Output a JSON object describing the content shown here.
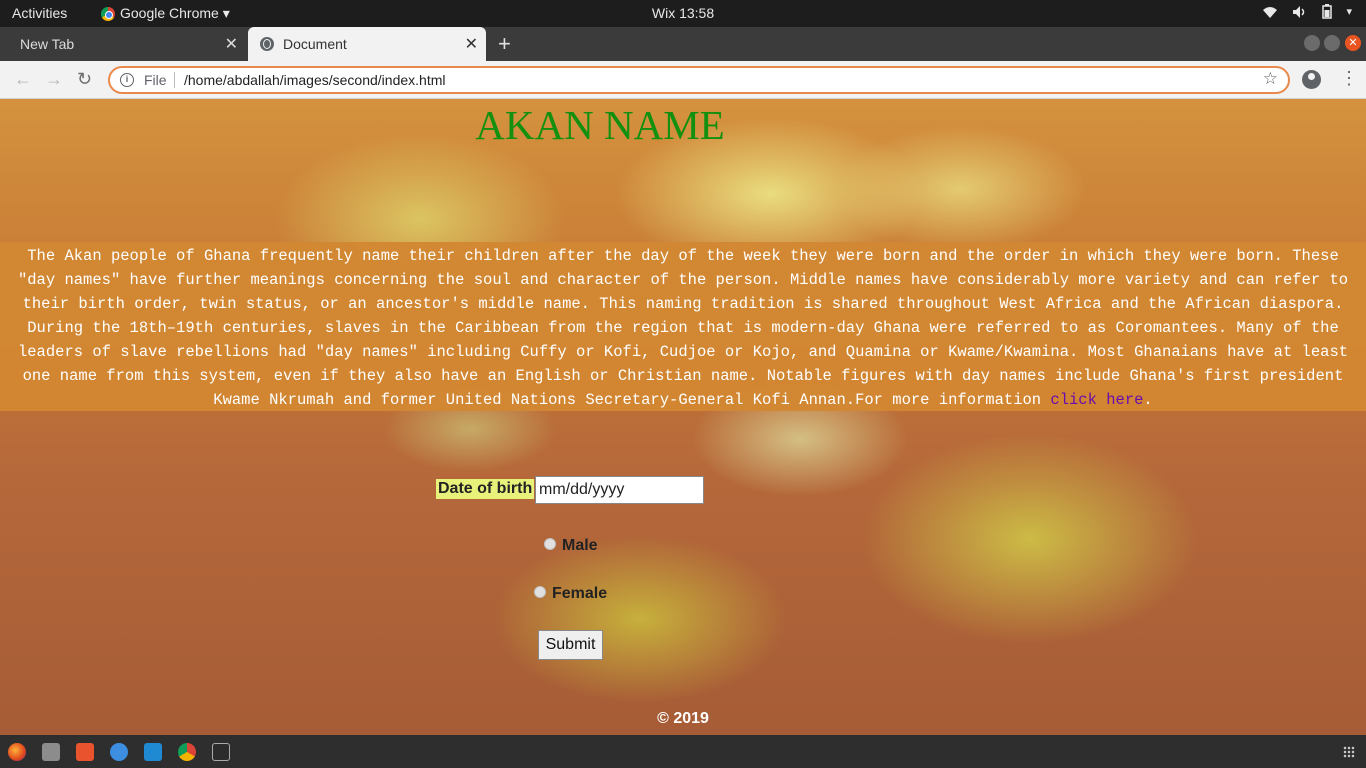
{
  "system_bar": {
    "activities": "Activities",
    "app_name": "Google Chrome ▾",
    "clock": "Wix 13:58"
  },
  "tabs": [
    {
      "label": "New Tab",
      "active": false
    },
    {
      "label": "Document",
      "active": true
    }
  ],
  "toolbar": {
    "scheme": "File",
    "url": "/home/abdallah/images/second/index.html"
  },
  "page": {
    "heading": "AKAN NAME",
    "intro_text": "The Akan people of Ghana frequently name their children after the day of the week they were born and the order in which they were born. These \"day names\" have further meanings concerning the soul and character of the person. Middle names have considerably more variety and can refer to their birth order, twin status, or an ancestor's middle name. This naming tradition is shared throughout West Africa and the African diaspora. During the 18th–19th centuries, slaves in the Caribbean from the region that is modern-day Ghana were referred to as Coromantees. Many of the leaders of slave rebellions had \"day names\" including Cuffy or Kofi, Cudjoe or Kojo, and Quamina or Kwame/Kwamina. Most Ghanaians have at least one name from this system, even if they also have an English or Christian name. Notable figures with day names include Ghana's first president Kwame Nkrumah and former United Nations Secretary-General Kofi Annan.For more information ",
    "intro_link": "click here",
    "intro_end": "."
  },
  "form": {
    "dob_label": "Date of birth",
    "dob_placeholder": "mm/dd/yyyy",
    "male_label": "Male",
    "female_label": "Female",
    "submit_label": "Submit"
  },
  "footer": "© 2019",
  "colors": {
    "heading": "#13900f",
    "intro_bg": "#d2872f",
    "link": "#6a0dad",
    "omnibox_focus": "#e9894b"
  }
}
